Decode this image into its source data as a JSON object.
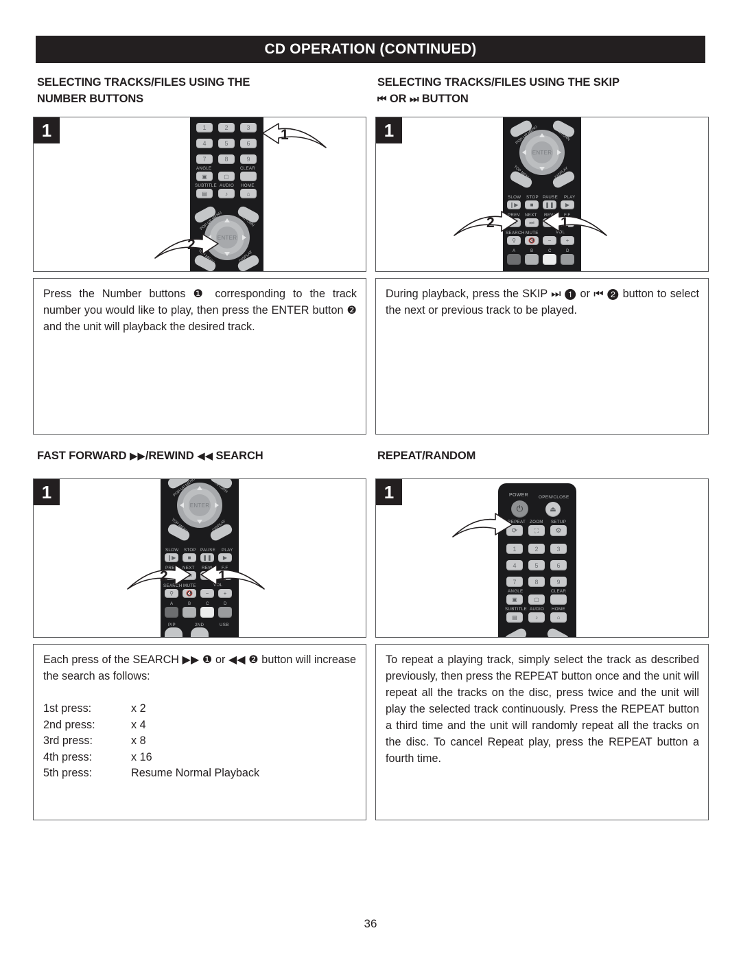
{
  "page": {
    "title": "CD OPERATION (CONTINUED)",
    "number": "36"
  },
  "sections": {
    "top_left": {
      "heading_line1": "SELECTING TRACKS/FILES USING THE",
      "heading_line2": "NUMBER BUTTONS",
      "step_badge": "1",
      "callouts": [
        "1",
        "2"
      ],
      "body": "Press the Number buttons ❶ corresponding to the track number you would like to play, then press the ENTER button ❷ and the unit will playback the desired track."
    },
    "top_right": {
      "heading_line1": "SELECTING TRACKS/FILES USING THE SKIP",
      "heading_glyph_prev": "⏮",
      "heading_or": "OR",
      "heading_glyph_next": "⏭",
      "heading_line2_tail": "BUTTON",
      "step_badge": "1",
      "callouts": [
        "1",
        "2"
      ],
      "body": "During playback, press the SKIP ⏭ ❶ or ⏮ ❷ button to select the next or previous track to be played."
    },
    "bottom_left": {
      "heading_prefix": "FAST FORWARD",
      "heading_ff_glyph": "▶▶",
      "heading_mid": "/REWIND",
      "heading_rew_glyph": "◀◀",
      "heading_suffix": "SEARCH",
      "step_badge": "1",
      "callouts": [
        "1",
        "2"
      ],
      "body_intro": "Each press of the SEARCH ▶▶ ❶ or ◀◀ ❷ button will increase the search as follows:",
      "press_table": [
        {
          "label": "1st press:",
          "value": "x 2"
        },
        {
          "label": "2nd press:",
          "value": "x 4"
        },
        {
          "label": "3rd press:",
          "value": "x 8"
        },
        {
          "label": "4th press:",
          "value": "x 16"
        },
        {
          "label": "5th press:",
          "value": "Resume Normal Playback"
        }
      ]
    },
    "bottom_right": {
      "heading": "REPEAT/RANDOM",
      "step_badge": "1",
      "body": "To repeat a playing track, simply select the track as described previously, then press the REPEAT button once and the unit will repeat all the tracks on the disc, press twice and the unit will play the selected track continuously. Press the REPEAT button a third time and the unit will randomly repeat all the tracks on the disc. To cancel Repeat play, press the REPEAT button a fourth time."
    }
  },
  "remote": {
    "numbers": [
      "1",
      "2",
      "3",
      "4",
      "5",
      "6",
      "7",
      "8",
      "9"
    ],
    "labels": {
      "power": "POWER",
      "open_close": "OPEN/CLOSE",
      "repeat": "REPEAT",
      "zoom": "ZOOM",
      "setup": "SETUP",
      "angle": "ANGLE",
      "clear": "CLEAR",
      "subtitle": "SUBTITLE",
      "audio": "AUDIO",
      "home": "HOME",
      "popup_menu": "POP-UP MENU",
      "return": "RETURN",
      "top_menu": "TOP MENU",
      "display": "DISPLAY",
      "enter": "ENTER",
      "slow": "SLOW",
      "stop": "STOP",
      "pause": "PAUSE",
      "play": "PLAY",
      "prev": "PREV",
      "next": "NEXT",
      "rew": "REW",
      "ff": "F.F",
      "search": "SEARCH",
      "mute": "MUTE",
      "vol": "VOL",
      "vol_minus": "−",
      "vol_plus": "+",
      "a": "A",
      "b": "B",
      "c": "C",
      "d": "D",
      "pip": "PIP",
      "second": "2ND",
      "usb": "USB"
    }
  },
  "colors": {
    "ink": "#231f20",
    "rule": "#58595b",
    "remote_body": "#1b1b1d",
    "key": "#c9cacc"
  }
}
